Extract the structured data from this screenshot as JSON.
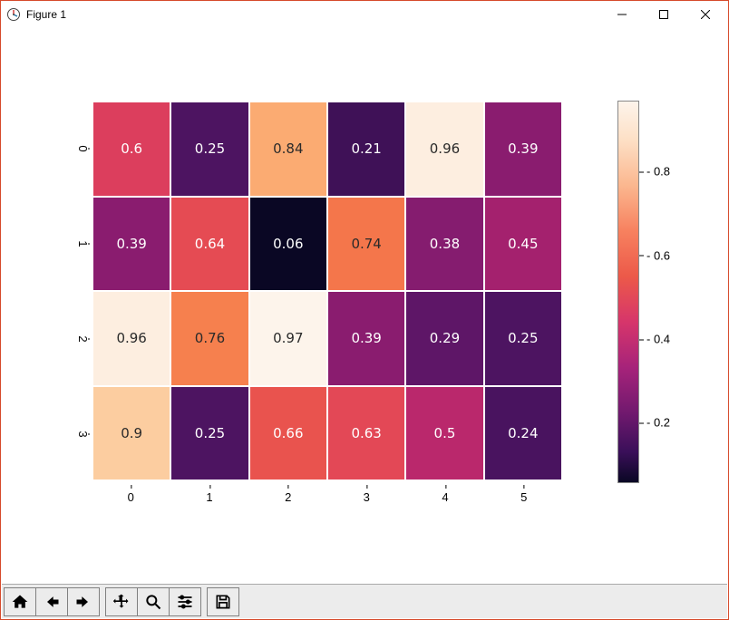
{
  "window": {
    "title": "Figure 1",
    "controls": {
      "minimize": "−",
      "maximize": "□",
      "close": "✕"
    }
  },
  "chart_data": {
    "type": "heatmap",
    "title": "",
    "row_labels": [
      "0",
      "1",
      "2",
      "3"
    ],
    "col_labels": [
      "0",
      "1",
      "2",
      "3",
      "4",
      "5"
    ],
    "values": [
      [
        0.6,
        0.25,
        0.84,
        0.21,
        0.96,
        0.39
      ],
      [
        0.39,
        0.64,
        0.06,
        0.74,
        0.38,
        0.45
      ],
      [
        0.96,
        0.76,
        0.97,
        0.39,
        0.29,
        0.25
      ],
      [
        0.9,
        0.25,
        0.66,
        0.63,
        0.5,
        0.24
      ]
    ],
    "value_format": "0.2f_trim",
    "cmap": "rocket",
    "colorbar": {
      "ticks": [
        0.2,
        0.4,
        0.6,
        0.8
      ],
      "vmin": 0.06,
      "vmax": 0.97
    },
    "cell_text_color_threshold": 0.7
  },
  "palette": {
    "rocket_stops": [
      {
        "t": 0.0,
        "hex": "#0a0724"
      },
      {
        "t": 0.1,
        "hex": "#2a0d46"
      },
      {
        "t": 0.2,
        "hex": "#4a1360"
      },
      {
        "t": 0.3,
        "hex": "#70196e"
      },
      {
        "t": 0.4,
        "hex": "#991e6f"
      },
      {
        "t": 0.5,
        "hex": "#c02a6b"
      },
      {
        "t": 0.6,
        "hex": "#de3f5c"
      },
      {
        "t": 0.7,
        "hex": "#f06044"
      },
      {
        "t": 0.8,
        "hex": "#f98e52"
      },
      {
        "t": 0.9,
        "hex": "#fcc18a"
      },
      {
        "t": 1.0,
        "hex": "#fdf4eb"
      }
    ]
  },
  "toolbar": {
    "items": [
      {
        "name": "home-icon"
      },
      {
        "name": "back-icon"
      },
      {
        "name": "forward-icon"
      },
      {
        "name": "pan-icon"
      },
      {
        "name": "zoom-icon"
      },
      {
        "name": "configure-icon"
      },
      {
        "name": "save-icon"
      }
    ]
  },
  "labels": {
    "cbar_prefix": "- "
  }
}
